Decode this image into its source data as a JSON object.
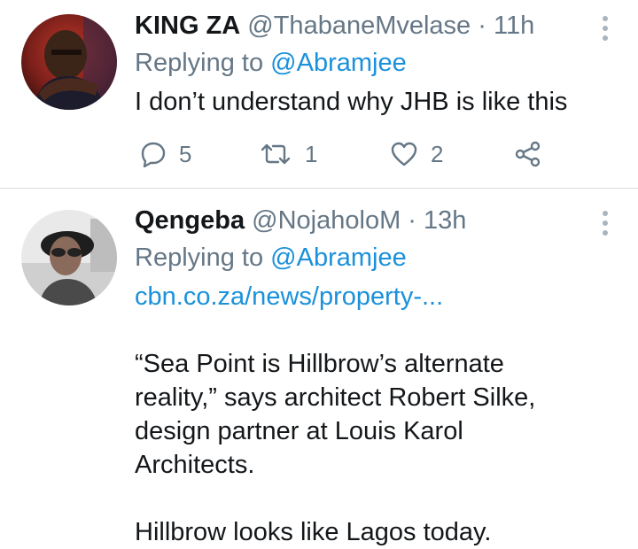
{
  "tweets": [
    {
      "name": "KING ZA",
      "handle": "@ThabaneMvelase",
      "separator": "·",
      "time": "11h",
      "replying_prefix": "Replying to",
      "replying_to": "@Abramjee",
      "text": "I don’t understand why JHB is like this",
      "actions": {
        "reply_count": "5",
        "retweet_count": "1",
        "like_count": "2"
      },
      "icons": {
        "reply": "reply-icon",
        "retweet": "retweet-icon",
        "like": "like-icon",
        "share": "share-icon",
        "more": "more-icon"
      }
    },
    {
      "name": "Qengeba",
      "handle": "@NojaholoM",
      "separator": "·",
      "time": "13h",
      "replying_prefix": "Replying to",
      "replying_to": "@Abramjee",
      "link": "cbn.co.za/news/property-...",
      "paragraph1": "“Sea Point is Hillbrow’s alternate reality,” says architect Robert Silke, design partner at Louis Karol Architects.",
      "paragraph2": "Hillbrow looks like Lagos today.",
      "icons": {
        "more": "more-icon"
      }
    }
  ],
  "colors": {
    "text": "#14171a",
    "secondary": "#657786",
    "accent": "#1a91da",
    "divider": "#d9dee2"
  }
}
